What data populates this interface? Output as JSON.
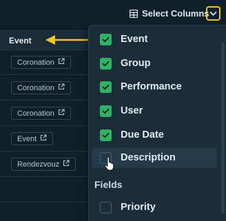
{
  "toolbar": {
    "select_columns_label": "Select Columns"
  },
  "table": {
    "header": "Event",
    "rows": [
      {
        "chip": "Coronation"
      },
      {
        "chip": "Coronation"
      },
      {
        "chip": "Coronation"
      },
      {
        "chip": "Event"
      },
      {
        "chip": "Rendezvouz"
      },
      {
        "chip": ""
      },
      {
        "chip": ""
      }
    ]
  },
  "dropdown": {
    "options": [
      {
        "label": "Event",
        "checked": true
      },
      {
        "label": "Group",
        "checked": true
      },
      {
        "label": "Performance",
        "checked": true
      },
      {
        "label": "User",
        "checked": true
      },
      {
        "label": "Due Date",
        "checked": true
      },
      {
        "label": "Description",
        "checked": false
      }
    ],
    "fields_section_label": "Fields",
    "field_options": [
      {
        "label": "Priority",
        "checked": false
      }
    ]
  },
  "colors": {
    "background": "#102029",
    "checkbox_checked": "#2fb363",
    "highlight_outline": "#f1c62a",
    "annotation_arrow": "#f1c62a"
  }
}
